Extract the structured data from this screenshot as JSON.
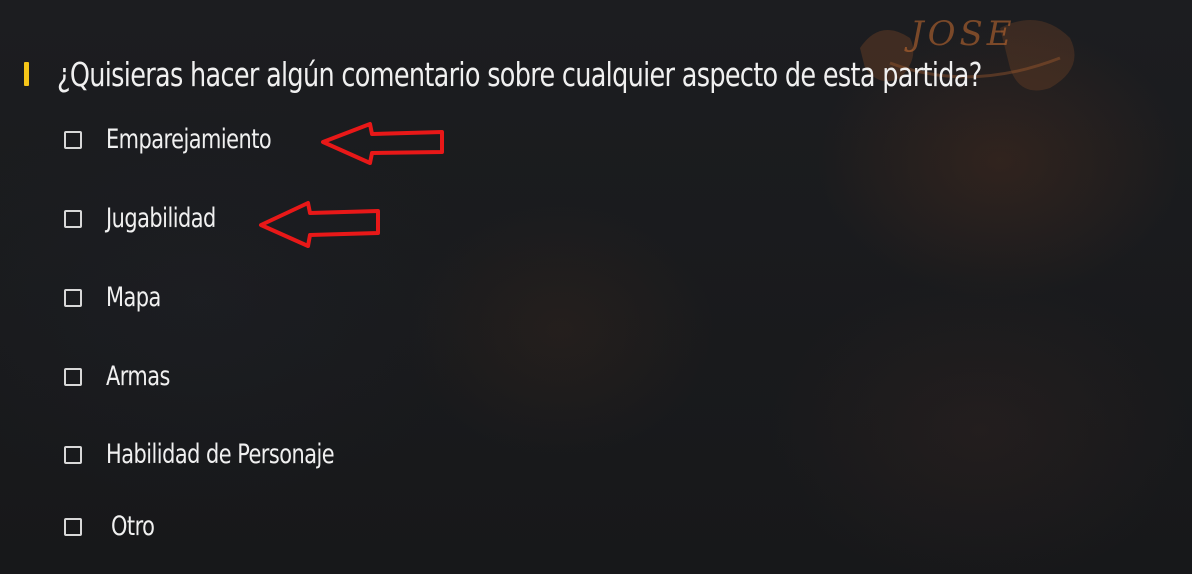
{
  "survey": {
    "question": "¿Quisieras hacer algún comentario sobre cualquier aspecto de esta partida?",
    "options": [
      {
        "label": "Emparejamiento",
        "checked": false
      },
      {
        "label": "Jugabilidad",
        "checked": false
      },
      {
        "label": "Mapa",
        "checked": false
      },
      {
        "label": "Armas",
        "checked": false
      },
      {
        "label": "Habilidad de Personaje",
        "checked": false
      },
      {
        "label": "Otro",
        "checked": false
      }
    ]
  },
  "watermark": {
    "text": "JOSE"
  },
  "colors": {
    "accent": "#f5c518",
    "annotation_arrow": "#e81818",
    "background": "#1a1b1d",
    "text": "#f0f0f0"
  },
  "annotations": {
    "arrow_icon": "left-arrow-outline-icon",
    "points_to": [
      "Emparejamiento",
      "Jugabilidad"
    ]
  }
}
